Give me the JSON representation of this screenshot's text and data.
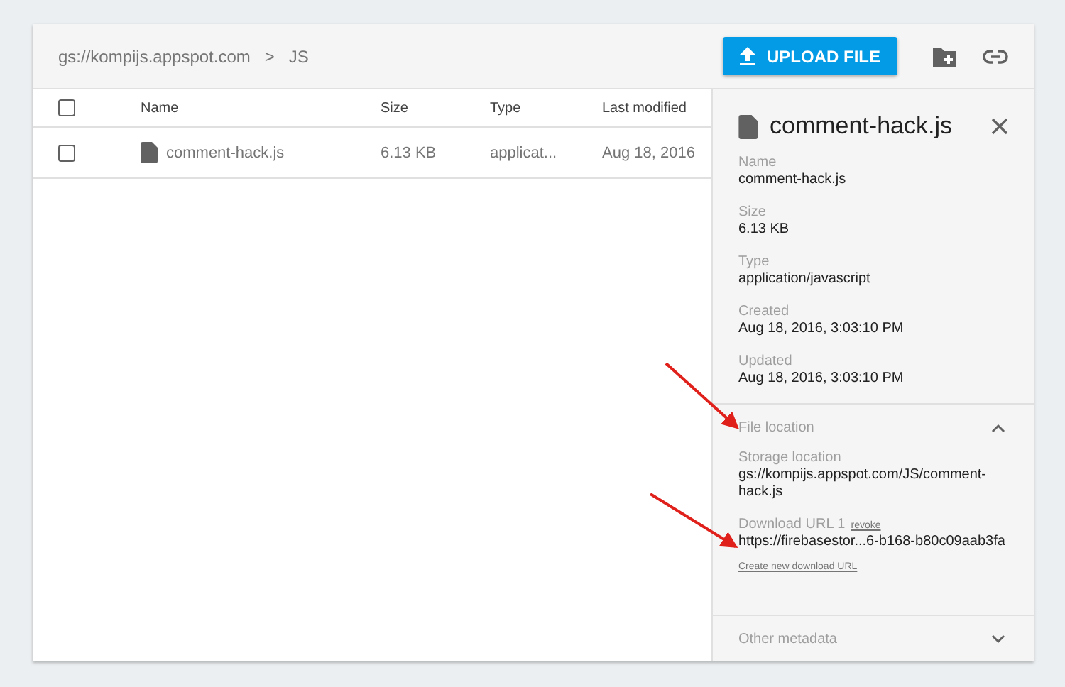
{
  "breadcrumb": {
    "bucket": "gs://kompijs.appspot.com",
    "separator": ">",
    "folder": "JS"
  },
  "toolbar": {
    "upload_button": "UPLOAD FILE"
  },
  "table": {
    "header_checked": false,
    "columns": [
      "Name",
      "Size",
      "Type",
      "Last modified"
    ],
    "rows": [
      {
        "checked": false,
        "name": "comment-hack.js",
        "size": "6.13 KB",
        "type": "applicat...",
        "modified": "Aug 18, 2016"
      }
    ]
  },
  "details": {
    "title": "comment-hack.js",
    "fields": [
      {
        "label": "Name",
        "value": "comment-hack.js"
      },
      {
        "label": "Size",
        "value": "6.13 KB"
      },
      {
        "label": "Type",
        "value": "application/javascript"
      },
      {
        "label": "Created",
        "value": "Aug 18, 2016, 3:03:10 PM"
      },
      {
        "label": "Updated",
        "value": "Aug 18, 2016, 3:03:10 PM"
      }
    ],
    "sections": [
      {
        "title": "File location",
        "expanded": true,
        "storage_label": "Storage location",
        "storage_value": "gs://kompijs.appspot.com/JS/comment-hack.js",
        "url_label": "Download URL 1",
        "revoke": "revoke",
        "url_value": "https://firebasestor...6-b168-b80c09aab3fa",
        "create_link": "Create new download URL"
      },
      {
        "title": "Other metadata",
        "expanded": false
      }
    ]
  }
}
